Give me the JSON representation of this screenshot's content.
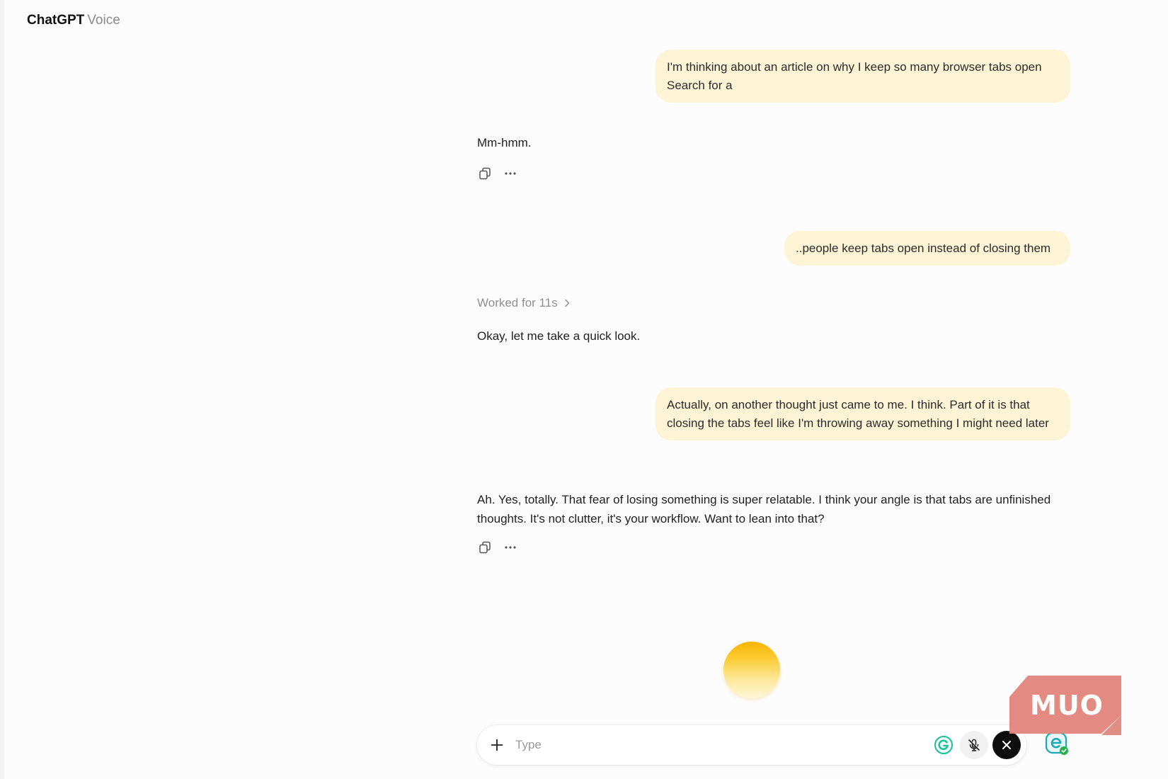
{
  "app": {
    "name": "ChatGPT",
    "mode": "Voice"
  },
  "messages": {
    "user_1": "I'm thinking about an article on why I keep so many browser tabs open Search for a",
    "assistant_1": "Mm-hmm.",
    "user_2": "..people keep tabs open instead of closing them",
    "worked_label": "Worked for 11s",
    "assistant_2": "Okay, let me take a quick look.",
    "user_3": "Actually, on another thought just came to me. I think. Part of it is that closing the tabs feel like I'm throwing away something I might need later",
    "assistant_3": "Ah. Yes, totally. That fear of losing something is super relatable. I think your angle is that tabs are unfinished thoughts. It's not clutter, it's your workflow. Want to lean into that?"
  },
  "composer": {
    "placeholder": "Type",
    "value": ""
  },
  "watermark": {
    "text": "MUO"
  },
  "icons": {
    "copy": "copy-icon",
    "more": "more-icon",
    "chevron": "chevron-right-icon",
    "plus": "plus-icon",
    "grammarly": "grammarly-icon",
    "mic": "mic-off-icon",
    "close": "close-icon",
    "extension": "extension-icon"
  },
  "colors": {
    "user_bubble": "#fdf4d6",
    "orb": "#fbc32a",
    "close_button": "#0d0d0d",
    "grammarly": "#15c39a",
    "watermark": "#e2857c"
  }
}
